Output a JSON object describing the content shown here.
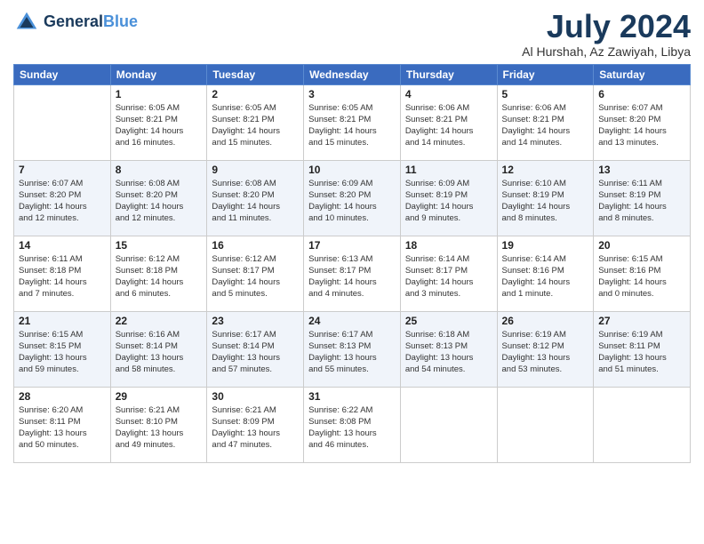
{
  "logo": {
    "text_general": "General",
    "text_blue": "Blue"
  },
  "header": {
    "month": "July 2024",
    "location": "Al Hurshah, Az Zawiyah, Libya"
  },
  "weekdays": [
    "Sunday",
    "Monday",
    "Tuesday",
    "Wednesday",
    "Thursday",
    "Friday",
    "Saturday"
  ],
  "weeks": [
    [
      {
        "day": "",
        "info": ""
      },
      {
        "day": "1",
        "info": "Sunrise: 6:05 AM\nSunset: 8:21 PM\nDaylight: 14 hours\nand 16 minutes."
      },
      {
        "day": "2",
        "info": "Sunrise: 6:05 AM\nSunset: 8:21 PM\nDaylight: 14 hours\nand 15 minutes."
      },
      {
        "day": "3",
        "info": "Sunrise: 6:05 AM\nSunset: 8:21 PM\nDaylight: 14 hours\nand 15 minutes."
      },
      {
        "day": "4",
        "info": "Sunrise: 6:06 AM\nSunset: 8:21 PM\nDaylight: 14 hours\nand 14 minutes."
      },
      {
        "day": "5",
        "info": "Sunrise: 6:06 AM\nSunset: 8:21 PM\nDaylight: 14 hours\nand 14 minutes."
      },
      {
        "day": "6",
        "info": "Sunrise: 6:07 AM\nSunset: 8:20 PM\nDaylight: 14 hours\nand 13 minutes."
      }
    ],
    [
      {
        "day": "7",
        "info": "Sunrise: 6:07 AM\nSunset: 8:20 PM\nDaylight: 14 hours\nand 12 minutes."
      },
      {
        "day": "8",
        "info": "Sunrise: 6:08 AM\nSunset: 8:20 PM\nDaylight: 14 hours\nand 12 minutes."
      },
      {
        "day": "9",
        "info": "Sunrise: 6:08 AM\nSunset: 8:20 PM\nDaylight: 14 hours\nand 11 minutes."
      },
      {
        "day": "10",
        "info": "Sunrise: 6:09 AM\nSunset: 8:20 PM\nDaylight: 14 hours\nand 10 minutes."
      },
      {
        "day": "11",
        "info": "Sunrise: 6:09 AM\nSunset: 8:19 PM\nDaylight: 14 hours\nand 9 minutes."
      },
      {
        "day": "12",
        "info": "Sunrise: 6:10 AM\nSunset: 8:19 PM\nDaylight: 14 hours\nand 8 minutes."
      },
      {
        "day": "13",
        "info": "Sunrise: 6:11 AM\nSunset: 8:19 PM\nDaylight: 14 hours\nand 8 minutes."
      }
    ],
    [
      {
        "day": "14",
        "info": "Sunrise: 6:11 AM\nSunset: 8:18 PM\nDaylight: 14 hours\nand 7 minutes."
      },
      {
        "day": "15",
        "info": "Sunrise: 6:12 AM\nSunset: 8:18 PM\nDaylight: 14 hours\nand 6 minutes."
      },
      {
        "day": "16",
        "info": "Sunrise: 6:12 AM\nSunset: 8:17 PM\nDaylight: 14 hours\nand 5 minutes."
      },
      {
        "day": "17",
        "info": "Sunrise: 6:13 AM\nSunset: 8:17 PM\nDaylight: 14 hours\nand 4 minutes."
      },
      {
        "day": "18",
        "info": "Sunrise: 6:14 AM\nSunset: 8:17 PM\nDaylight: 14 hours\nand 3 minutes."
      },
      {
        "day": "19",
        "info": "Sunrise: 6:14 AM\nSunset: 8:16 PM\nDaylight: 14 hours\nand 1 minute."
      },
      {
        "day": "20",
        "info": "Sunrise: 6:15 AM\nSunset: 8:16 PM\nDaylight: 14 hours\nand 0 minutes."
      }
    ],
    [
      {
        "day": "21",
        "info": "Sunrise: 6:15 AM\nSunset: 8:15 PM\nDaylight: 13 hours\nand 59 minutes."
      },
      {
        "day": "22",
        "info": "Sunrise: 6:16 AM\nSunset: 8:14 PM\nDaylight: 13 hours\nand 58 minutes."
      },
      {
        "day": "23",
        "info": "Sunrise: 6:17 AM\nSunset: 8:14 PM\nDaylight: 13 hours\nand 57 minutes."
      },
      {
        "day": "24",
        "info": "Sunrise: 6:17 AM\nSunset: 8:13 PM\nDaylight: 13 hours\nand 55 minutes."
      },
      {
        "day": "25",
        "info": "Sunrise: 6:18 AM\nSunset: 8:13 PM\nDaylight: 13 hours\nand 54 minutes."
      },
      {
        "day": "26",
        "info": "Sunrise: 6:19 AM\nSunset: 8:12 PM\nDaylight: 13 hours\nand 53 minutes."
      },
      {
        "day": "27",
        "info": "Sunrise: 6:19 AM\nSunset: 8:11 PM\nDaylight: 13 hours\nand 51 minutes."
      }
    ],
    [
      {
        "day": "28",
        "info": "Sunrise: 6:20 AM\nSunset: 8:11 PM\nDaylight: 13 hours\nand 50 minutes."
      },
      {
        "day": "29",
        "info": "Sunrise: 6:21 AM\nSunset: 8:10 PM\nDaylight: 13 hours\nand 49 minutes."
      },
      {
        "day": "30",
        "info": "Sunrise: 6:21 AM\nSunset: 8:09 PM\nDaylight: 13 hours\nand 47 minutes."
      },
      {
        "day": "31",
        "info": "Sunrise: 6:22 AM\nSunset: 8:08 PM\nDaylight: 13 hours\nand 46 minutes."
      },
      {
        "day": "",
        "info": ""
      },
      {
        "day": "",
        "info": ""
      },
      {
        "day": "",
        "info": ""
      }
    ]
  ]
}
